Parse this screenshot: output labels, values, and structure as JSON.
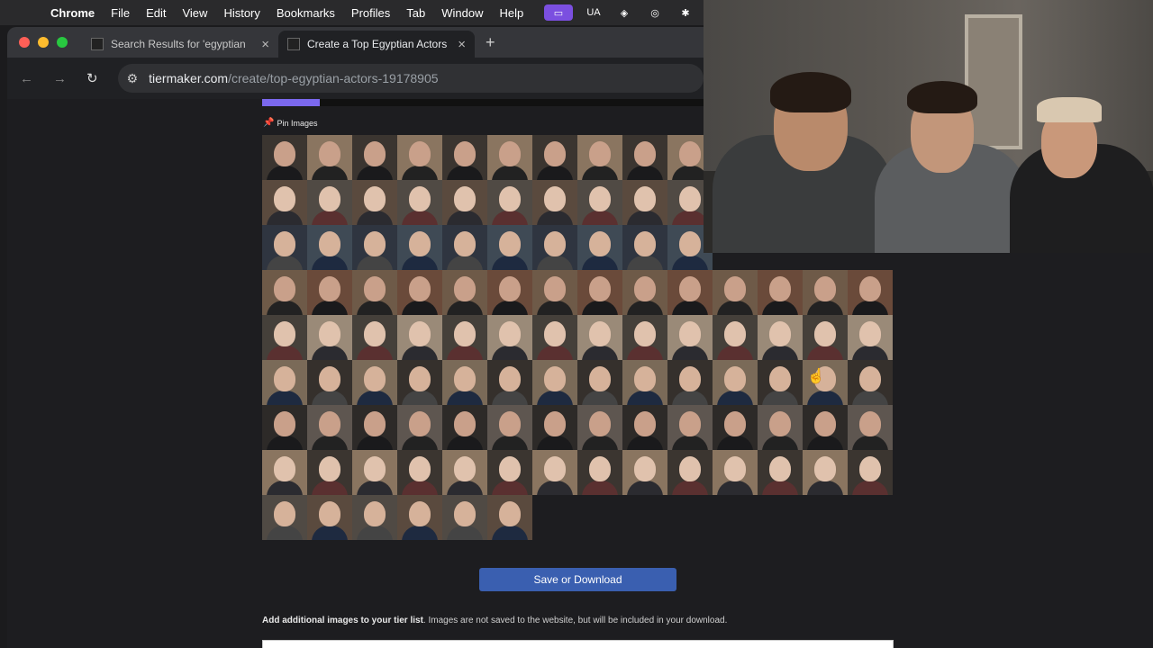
{
  "menubar": {
    "app": "Chrome",
    "items": [
      "File",
      "Edit",
      "View",
      "History",
      "Bookmarks",
      "Profiles",
      "Tab",
      "Window",
      "Help"
    ],
    "tray_text": "UA"
  },
  "tabs": [
    {
      "title": "Search Results for 'egyptian",
      "active": false
    },
    {
      "title": "Create a Top Egyptian Actors",
      "active": true
    }
  ],
  "address": {
    "host": "tiermaker.com",
    "path": "/create/top-egyptian-actors-19178905"
  },
  "page": {
    "pin_label": "Pin Images",
    "save_button": "Save or Download",
    "add_note_bold": "Add additional images to your tier list",
    "add_note_rest": ". Images are not saved to the website, but will be included in your download."
  },
  "colors": {
    "accent": "#7b68ee",
    "save_button": "#3a5fb0"
  },
  "image_grid": {
    "rows_full": 8,
    "columns": 14,
    "last_row_count": 6
  }
}
